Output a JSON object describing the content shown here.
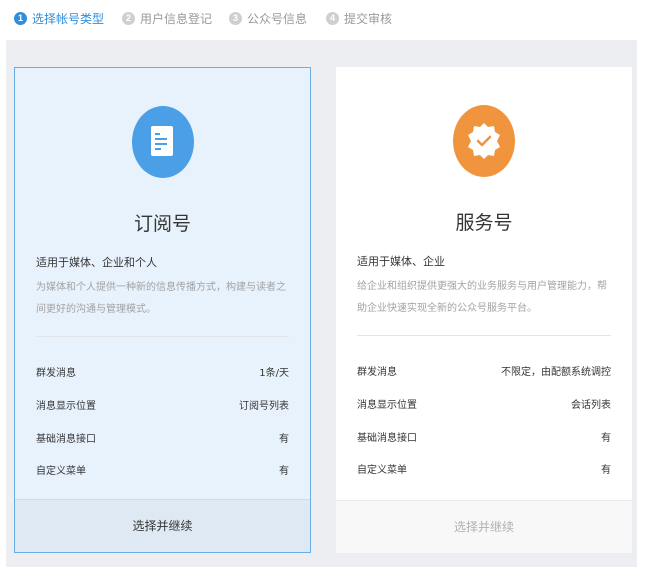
{
  "steps": [
    {
      "num": "1",
      "label": "选择帐号类型"
    },
    {
      "num": "2",
      "label": "用户信息登记"
    },
    {
      "num": "3",
      "label": "公众号信息"
    },
    {
      "num": "4",
      "label": "提交审核"
    }
  ],
  "cards": [
    {
      "icon": "document-icon",
      "icon_color": "#4a9fe6",
      "title": "订阅号",
      "subtitle": "适用于媒体、企业和个人",
      "description": "为媒体和个人提供一种新的信息传播方式，构建与读者之间更好的沟通与管理模式。",
      "features": [
        {
          "key": "群发消息",
          "value": "1条/天"
        },
        {
          "key": "消息显示位置",
          "value": "订阅号列表"
        },
        {
          "key": "基础消息接口",
          "value": "有"
        },
        {
          "key": "自定义菜单",
          "value": "有"
        }
      ],
      "action": "选择并继续"
    },
    {
      "icon": "verified-badge-icon",
      "icon_color": "#f0953e",
      "title": "服务号",
      "subtitle": "适用于媒体、企业",
      "description": "给企业和组织提供更强大的业务服务与用户管理能力，帮助企业快速实现全新的公众号服务平台。",
      "features": [
        {
          "key": "群发消息",
          "value": "不限定，由配额系统调控"
        },
        {
          "key": "消息显示位置",
          "value": "会话列表"
        },
        {
          "key": "基础消息接口",
          "value": "有"
        },
        {
          "key": "自定义菜单",
          "value": "有"
        }
      ],
      "action": "选择并继续"
    }
  ]
}
